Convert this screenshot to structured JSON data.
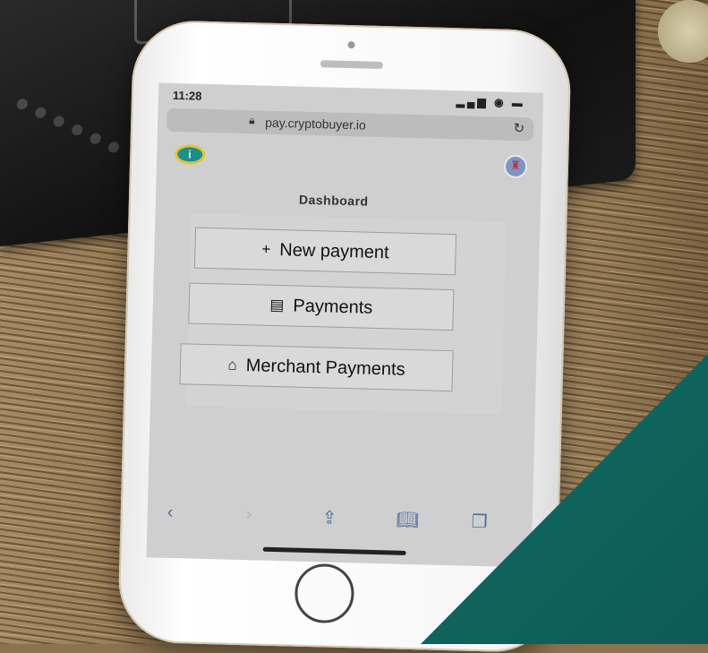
{
  "status": {
    "time": "11:28",
    "icons": "▂▄▆ ◉ ▬"
  },
  "browser": {
    "url": "pay.cryptobuyer.io"
  },
  "page": {
    "title": "Dashboard"
  },
  "menu": {
    "new_payment": {
      "glyph": "+",
      "label": "New payment"
    },
    "payments": {
      "glyph": "▤",
      "label": "Payments"
    },
    "merchant_payments": {
      "glyph": "⌂",
      "label": "Merchant Payments"
    }
  },
  "toolbar_icons": [
    "chevron-left-icon",
    "chevron-right-icon",
    "share-icon",
    "bookmarks-icon",
    "tabs-icon"
  ],
  "colors": {
    "accent_teal": "#10655d",
    "toolbar_blue": "#4d6fa0"
  }
}
